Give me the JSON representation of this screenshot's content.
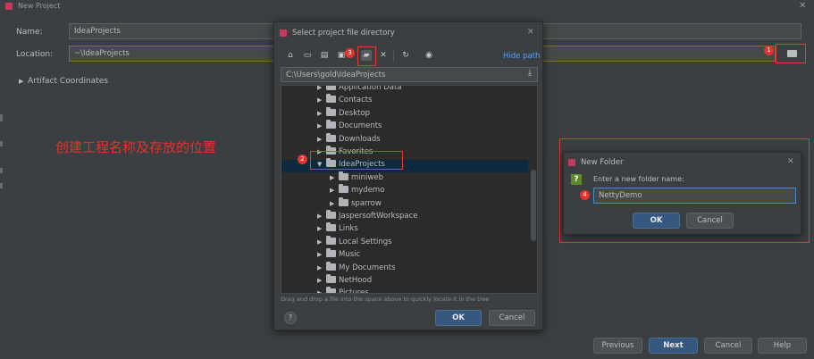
{
  "window": {
    "title": "New Project",
    "close": "✕"
  },
  "form": {
    "name_label": "Name:",
    "name_value": "IdeaProjects",
    "location_label": "Location:",
    "location_value": "~\\IdeaProjects",
    "artifact_label": "Artifact Coordinates"
  },
  "annotation": {
    "text": "创建工程名称及存放的位置"
  },
  "badges": {
    "b1": "1",
    "b2": "2",
    "b3": "3",
    "b4": "4"
  },
  "file_dialog": {
    "title": "Select project file directory",
    "hide_path": "Hide path",
    "path": "C:\\Users\\gold\\IdeaProjects",
    "tree": [
      {
        "label": "Application Data",
        "level": 0,
        "expanded": false
      },
      {
        "label": "Contacts",
        "level": 0,
        "expanded": false
      },
      {
        "label": "Desktop",
        "level": 0,
        "expanded": false
      },
      {
        "label": "Documents",
        "level": 0,
        "expanded": false
      },
      {
        "label": "Downloads",
        "level": 0,
        "expanded": false
      },
      {
        "label": "Favorites",
        "level": 0,
        "expanded": false
      },
      {
        "label": "IdeaProjects",
        "level": 0,
        "expanded": true,
        "selected": true
      },
      {
        "label": "miniweb",
        "level": 1,
        "expanded": false
      },
      {
        "label": "mydemo",
        "level": 1,
        "expanded": false
      },
      {
        "label": "sparrow",
        "level": 1,
        "expanded": false
      },
      {
        "label": "JaspersoftWorkspace",
        "level": 0,
        "expanded": false
      },
      {
        "label": "Links",
        "level": 0,
        "expanded": false
      },
      {
        "label": "Local Settings",
        "level": 0,
        "expanded": false
      },
      {
        "label": "Music",
        "level": 0,
        "expanded": false
      },
      {
        "label": "My Documents",
        "level": 0,
        "expanded": false
      },
      {
        "label": "NetHood",
        "level": 0,
        "expanded": false
      },
      {
        "label": "Pictures",
        "level": 0,
        "expanded": false
      }
    ],
    "hint": "Drag and drop a file into the space above to quickly locate it in the tree",
    "ok": "OK",
    "cancel": "Cancel",
    "help": "?"
  },
  "new_folder": {
    "title": "New Folder",
    "prompt": "Enter a new folder name:",
    "value": "NettyDemo",
    "ok": "OK",
    "cancel": "Cancel"
  },
  "footer": {
    "previous": "Previous",
    "next": "Next",
    "cancel": "Cancel",
    "help": "Help"
  }
}
